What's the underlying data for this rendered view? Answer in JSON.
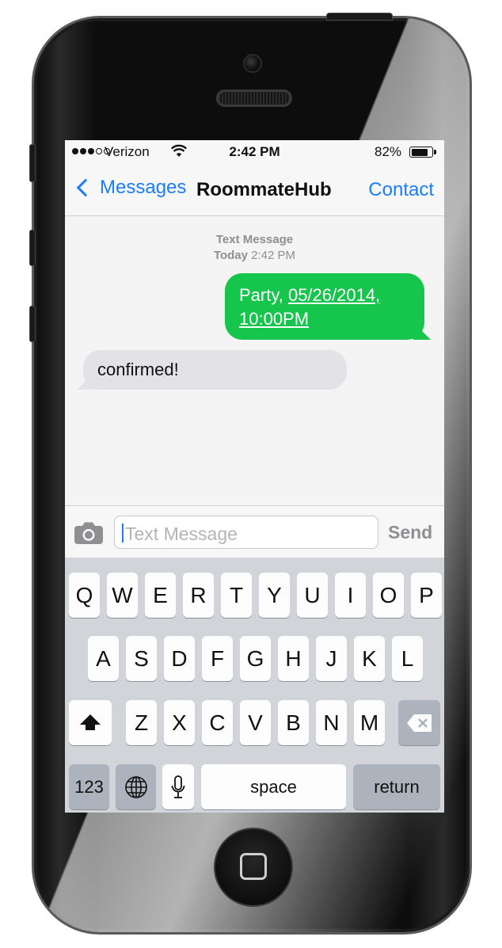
{
  "status_bar": {
    "carrier": "Verizon",
    "time": "2:42 PM",
    "battery": "82%",
    "battery_level": 0.82,
    "signal_filled": 3,
    "signal_total": 5
  },
  "nav": {
    "back_label": "Messages",
    "title": "RoommateHub",
    "contact_label": "Contact"
  },
  "conversation": {
    "meta_line1": "Text Message",
    "meta_day": "Today",
    "meta_time": "2:42 PM",
    "sent_prefix": "Party, ",
    "sent_link_line1": "05/26/2014,",
    "sent_link_line2": "10:00PM",
    "received_text": "confirmed!"
  },
  "input": {
    "placeholder": "Text Message",
    "send_label": "Send"
  },
  "keyboard": {
    "row1": [
      "Q",
      "W",
      "E",
      "R",
      "T",
      "Y",
      "U",
      "I",
      "O",
      "P"
    ],
    "row2": [
      "A",
      "S",
      "D",
      "F",
      "G",
      "H",
      "J",
      "K",
      "L"
    ],
    "row3": [
      "Z",
      "X",
      "C",
      "V",
      "B",
      "N",
      "M"
    ],
    "numbers_label": "123",
    "space_label": "space",
    "return_label": "return"
  },
  "colors": {
    "accent_blue": "#1a7efb",
    "sent_bubble": "#16c54c",
    "received_bubble": "#e3e3e7",
    "keyboard_bg": "#d1d4d9"
  },
  "icons": [
    "chevron-left-icon",
    "wifi-icon",
    "battery-icon",
    "camera-icon",
    "shift-icon",
    "delete-icon",
    "globe-icon",
    "microphone-icon",
    "home-button-icon"
  ]
}
